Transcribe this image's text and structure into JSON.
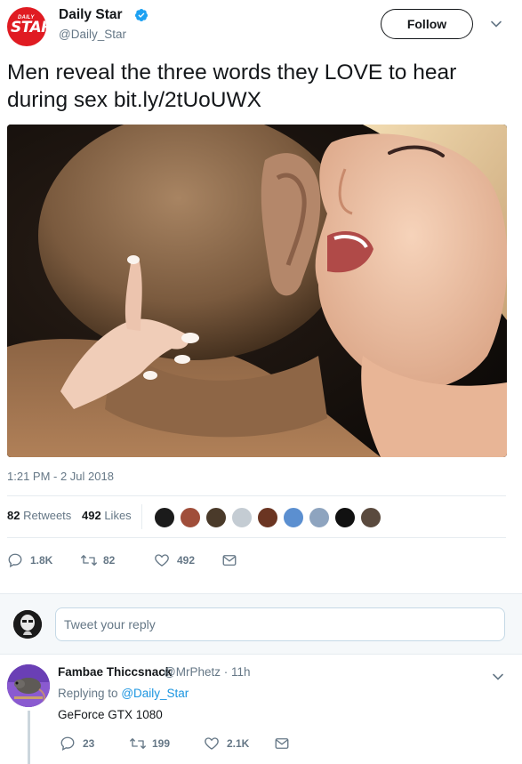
{
  "author": {
    "display_name": "Daily Star",
    "handle": "@Daily_Star",
    "logo_small": "DAILY",
    "logo_big": "STAR",
    "verified": true,
    "follow_label": "Follow"
  },
  "tweet": {
    "text": "Men reveal the three words they LOVE to hear during sex bit.ly/2tUoUWX",
    "timestamp": "1:21 PM - 2 Jul 2018",
    "retweets_count": "82",
    "retweets_label": "Retweets",
    "likes_count": "492",
    "likes_label": "Likes",
    "actions": {
      "reply_count": "1.8K",
      "retweet_count": "82",
      "like_count": "492"
    }
  },
  "reply_box": {
    "placeholder": "Tweet your reply"
  },
  "reply": {
    "display_name": "Fambae Thiccsnack",
    "handle_time": "@MrPhetz · 11h",
    "replying_prefix": "Replying to",
    "replying_to": "@Daily_Star",
    "text": "GeForce GTX 1080",
    "actions": {
      "reply_count": "23",
      "retweet_count": "199",
      "like_count": "2.1K"
    }
  },
  "colors": {
    "brand_red": "#e01b22",
    "verified_blue": "#1da1f2",
    "link_blue": "#1b95e0",
    "muted": "#657786",
    "text": "#14171a"
  }
}
